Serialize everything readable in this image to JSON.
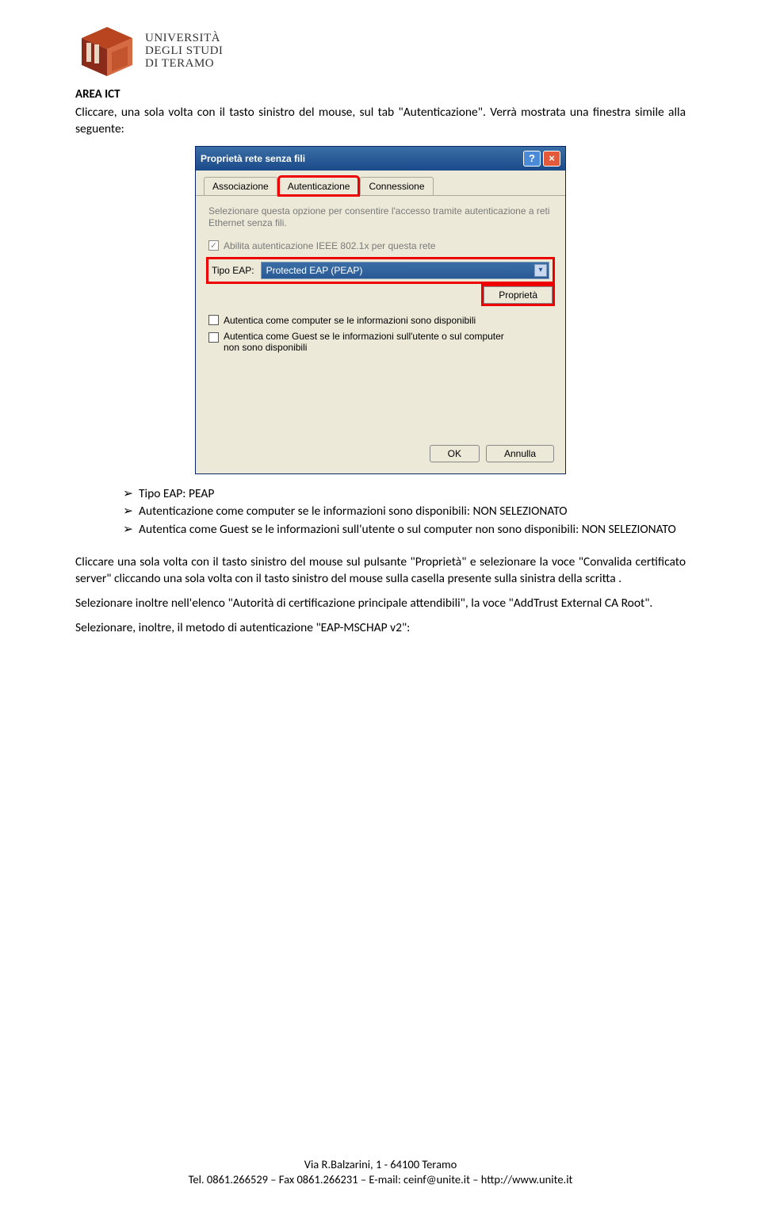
{
  "header": {
    "uni_line1": "UNIVERSITÀ",
    "uni_line2": "DEGLI STUDI",
    "uni_line3": "DI TERAMO",
    "area": "AREA ICT"
  },
  "para1": "Cliccare, una sola volta con il tasto sinistro del mouse, sul tab \"Autenticazione\". Verrà mostrata una finestra simile alla seguente:",
  "dialog": {
    "title": "Proprietà rete senza fili",
    "tabs": {
      "assoc": "Associazione",
      "auth": "Autenticazione",
      "conn": "Connessione"
    },
    "desc": "Selezionare questa opzione per consentire l'accesso tramite autenticazione a reti Ethernet senza fili.",
    "chk_enable": "Abilita autenticazione IEEE 802.1x per questa rete",
    "eap_label": "Tipo EAP:",
    "eap_value": "Protected EAP (PEAP)",
    "prop_btn": "Proprietà",
    "chk_comp": "Autentica come computer se le informazioni sono disponibili",
    "chk_guest": "Autentica come Guest se le informazioni sull'utente o sul computer non sono disponibili",
    "ok": "OK",
    "cancel": "Annulla"
  },
  "bullets": {
    "b1": "Tipo EAP:  PEAP",
    "b2": "Autenticazione come computer se le informazioni sono disponibili:  NON SELEZIONATO",
    "b3": "Autentica come Guest se le informazioni sull'utente o sul computer non sono disponibili:  NON SELEZIONATO"
  },
  "para2": "Cliccare una sola volta con il tasto sinistro del mouse sul pulsante \"Proprietà\" e selezionare la voce \"Convalida certificato server\" cliccando una sola volta con il tasto sinistro del  mouse  sulla  casella presente sulla sinistra della scritta .",
  "para3": "Selezionare inoltre nell'elenco \"Autorità di certificazione principale attendibili\", la voce \"AddTrust External CA Root\".",
  "para4": "Selezionare, inoltre, il metodo di autenticazione \"EAP-MSCHAP v2\":",
  "footer": {
    "line1": "Via R.Balzarini, 1 - 64100 Teramo",
    "line2": "Tel. 0861.266529 – Fax 0861.266231 – E-mail: ceinf@unite.it – http://www.unite.it"
  }
}
